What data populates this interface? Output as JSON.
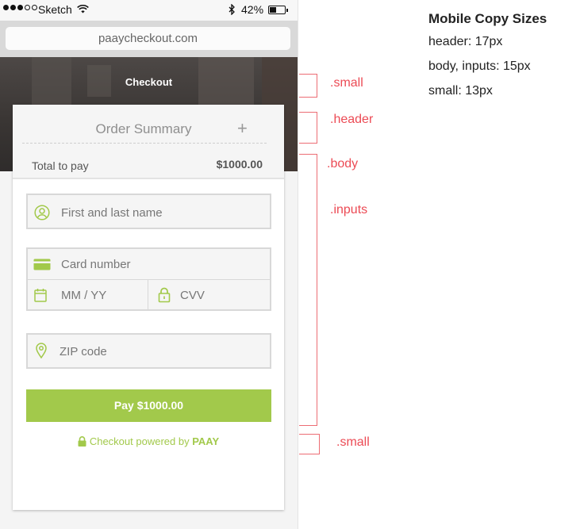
{
  "status_bar": {
    "carrier": "Sketch",
    "battery_percent": "42%",
    "icons": [
      "signal-dots-icon",
      "wifi-icon",
      "bluetooth-icon",
      "battery-icon"
    ]
  },
  "browser": {
    "url": "paaycheckout.com"
  },
  "hero": {
    "title": "Checkout"
  },
  "order_summary": {
    "title": "Order Summary",
    "toggle": "+",
    "total_label": "Total to pay",
    "total_amount": "$1000.00"
  },
  "form": {
    "name_placeholder": "First and last name",
    "card_number_placeholder": "Card number",
    "expiry_placeholder": "MM / YY",
    "cvv_placeholder": "CVV",
    "zip_placeholder": "ZIP code",
    "icons": {
      "name": "user-icon",
      "card": "credit-card-icon",
      "expiry": "calendar-icon",
      "cvv": "lock-icon",
      "zip": "location-pin-icon"
    }
  },
  "pay_button": {
    "label": "Pay $1000.00"
  },
  "footer": {
    "powered_text": "Checkout powered by",
    "brand": "PAAY"
  },
  "annotations": [
    {
      "label": ".small"
    },
    {
      "label": ".header"
    },
    {
      "label": ".body"
    },
    {
      "label": ".inputs"
    },
    {
      "label": ".small"
    }
  ],
  "legend": {
    "title": "Mobile Copy Sizes",
    "lines": [
      "header: 17px",
      "body, inputs: 15px",
      "small: 13px"
    ]
  },
  "colors": {
    "accent_green": "#a2c94b",
    "annotation_red": "#ec4b55",
    "hero_dark": "#3a3634"
  }
}
